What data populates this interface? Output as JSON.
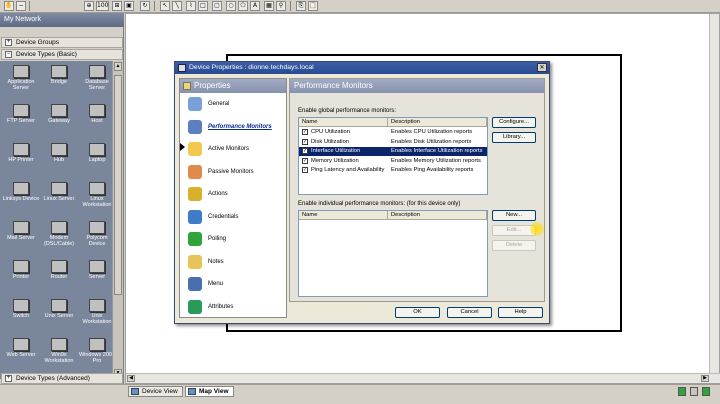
{
  "toolbar": {
    "buttons": [
      "hand",
      "zoom-out",
      "zoom-in",
      "zoom-level",
      "zoom-area",
      "fit",
      "select",
      "line",
      "rectangle",
      "rounded-rect",
      "ellipse",
      "polygon",
      "text",
      "image",
      "copy",
      "paste"
    ],
    "zoom_value": "100"
  },
  "left_panel": {
    "title": "My Network",
    "device_groups": "Device Groups",
    "device_types_basic": "Device Types (Basic)",
    "device_types_advanced": "Device Types (Advanced)",
    "devices": [
      {
        "label": "Application Server"
      },
      {
        "label": "Bridge"
      },
      {
        "label": "Database Server"
      },
      {
        "label": "FTP Server"
      },
      {
        "label": "Gateway"
      },
      {
        "label": "Host"
      },
      {
        "label": "HP Printer"
      },
      {
        "label": "Hub"
      },
      {
        "label": "Laptop"
      },
      {
        "label": "Linksys Device"
      },
      {
        "label": "Linux Server"
      },
      {
        "label": "Linux Workstation"
      },
      {
        "label": "Mail Server"
      },
      {
        "label": "Modem (DSL/Cable)"
      },
      {
        "label": "Polycom Device"
      },
      {
        "label": "Printer"
      },
      {
        "label": "Router"
      },
      {
        "label": "Server"
      },
      {
        "label": "Switch"
      },
      {
        "label": "Unix Server"
      },
      {
        "label": "Unix Workstation"
      },
      {
        "label": "Web Server"
      },
      {
        "label": "Win9x Workstation"
      },
      {
        "label": "Windows 2000 Pro"
      }
    ]
  },
  "bottom_bar": {
    "tabs": [
      {
        "label": "Device View"
      },
      {
        "label": "Map View"
      }
    ]
  },
  "dialog": {
    "title": "Device Properties : dionne.techdays.local",
    "nav_header": "Properties",
    "nav_items": [
      {
        "label": "General",
        "icon": "general-icon",
        "color": "#7aa0d8"
      },
      {
        "label": "Performance Monitors",
        "icon": "performance-icon",
        "color": "#5c7fbf"
      },
      {
        "label": "Active Monitors",
        "icon": "lightbulb-icon",
        "color": "#f2c94c"
      },
      {
        "label": "Passive Monitors",
        "icon": "clock-icon",
        "color": "#e08a4e"
      },
      {
        "label": "Actions",
        "icon": "lightning-icon",
        "color": "#d8b02b"
      },
      {
        "label": "Credentials",
        "icon": "credentials-icon",
        "color": "#3f7bc8"
      },
      {
        "label": "Polling",
        "icon": "polling-icon",
        "color": "#2fa43a"
      },
      {
        "label": "Notes",
        "icon": "notes-icon",
        "color": "#e7c35a"
      },
      {
        "label": "Menu",
        "icon": "menu-icon",
        "color": "#4a6fb0"
      },
      {
        "label": "Attributes",
        "icon": "attributes-icon",
        "color": "#2a9a58"
      }
    ],
    "content_header": "Performance Monitors",
    "global_label": "Enable global performance monitors:",
    "individual_label": "Enable individual performance monitors: (for this device only)",
    "columns": {
      "name": "Name",
      "description": "Description"
    },
    "global_rows": [
      {
        "checked": true,
        "name": "CPU Utilization",
        "description": "Enables CPU Utilization reports",
        "selected": false
      },
      {
        "checked": true,
        "name": "Disk Utilization",
        "description": "Enables Disk Utilization reports",
        "selected": false
      },
      {
        "checked": true,
        "name": "Interface Utilization",
        "description": "Enables Interface Utilization reports",
        "selected": true
      },
      {
        "checked": true,
        "name": "Memory Utilization",
        "description": "Enables Memory Utilization reports",
        "selected": false
      },
      {
        "checked": true,
        "name": "Ping Latency and Availability",
        "description": "Enables Ping Availability reports",
        "selected": false
      }
    ],
    "buttons": {
      "configure": "Configure...",
      "library": "Library...",
      "new": "New...",
      "edit": "Edit...",
      "delete": "Delete",
      "ok": "OK",
      "cancel": "Cancel",
      "help": "Help"
    },
    "accent": "#0b246a",
    "title_bar_color": "#274a92"
  }
}
